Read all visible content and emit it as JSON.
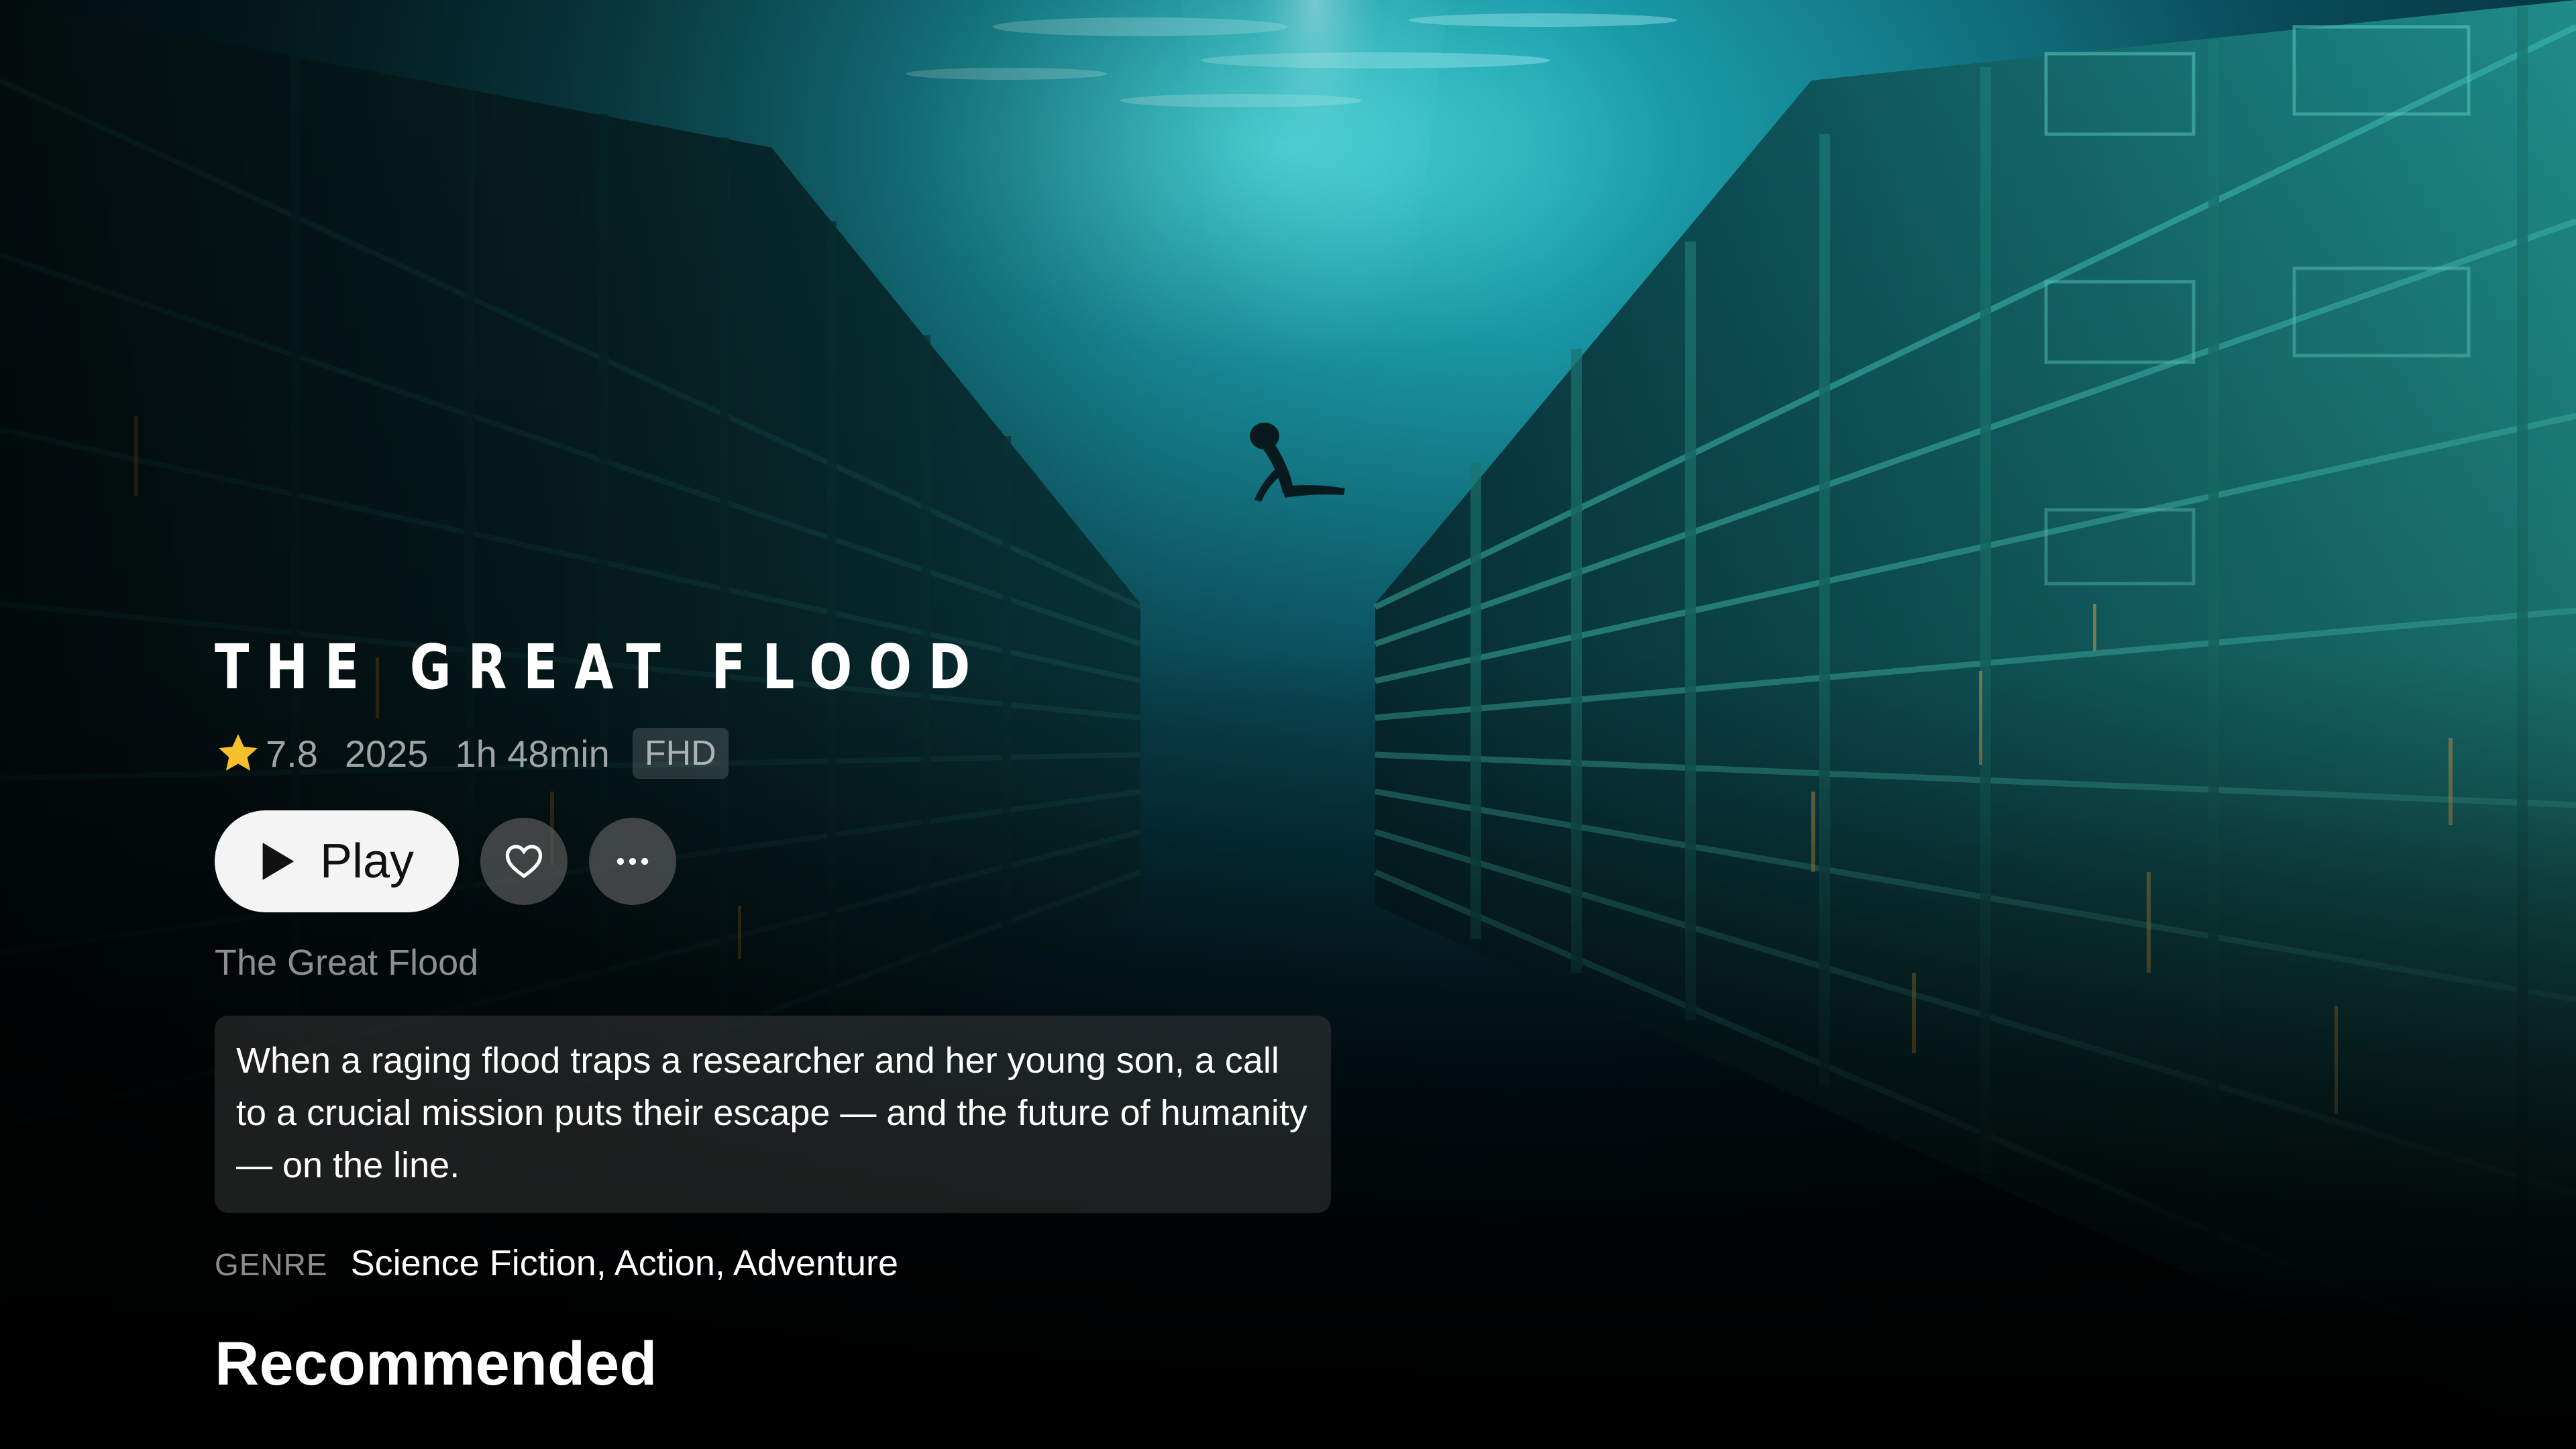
{
  "hero": {
    "title": "THE GREAT FLOOD",
    "rating": "7.8",
    "year": "2025",
    "duration": "1h 48min",
    "quality": "FHD",
    "original_title": "The Great Flood",
    "synopsis": "When a raging flood traps a researcher and her young son, a call to a crucial mission puts their escape — and the future of humanity — on the line.",
    "genre_label": "GENRE",
    "genre_value": "Science Fiction, Action, Adventure"
  },
  "actions": {
    "play_label": "Play",
    "favorite_icon": "heart-icon",
    "more_icon": "ellipsis-icon"
  },
  "sections": {
    "recommended_heading": "Recommended"
  },
  "colors": {
    "water_top": "#3fd6dc",
    "water_mid": "#0b5a6a",
    "water_deep": "#021418",
    "building_tint": "#1c6f73",
    "star": "#f5c02c",
    "play_button_bg": "#f4f4f4"
  }
}
